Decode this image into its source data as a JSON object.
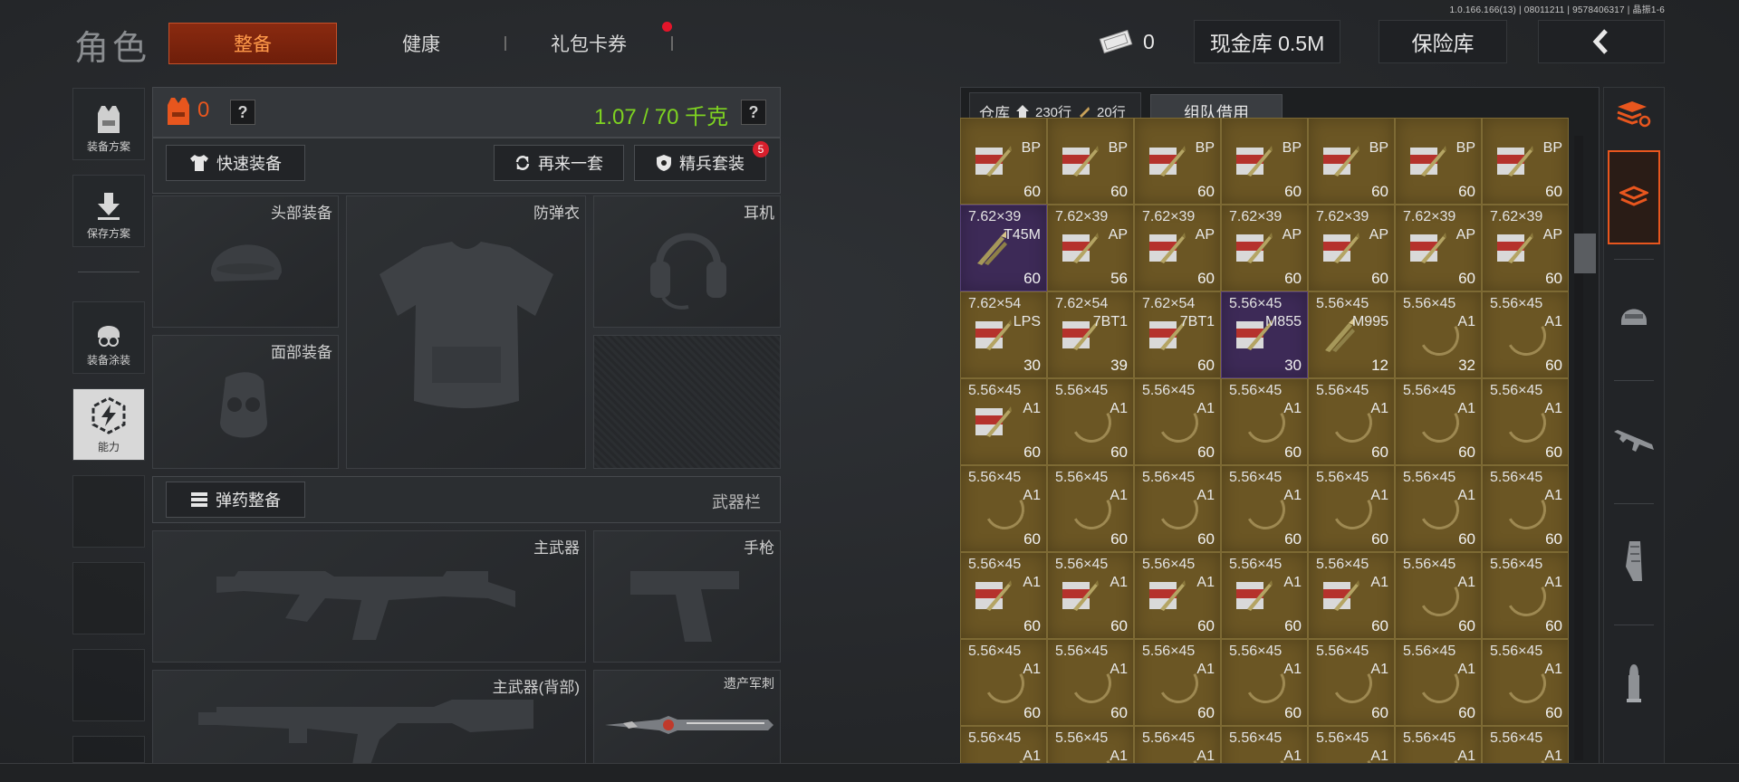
{
  "version": "1.0.166.166(13) | 08011211 | 9578406317 | 晶振1-6",
  "header": {
    "title": "角色",
    "tabs": [
      {
        "label": "整备",
        "active": true
      },
      {
        "label": "健康",
        "active": false
      },
      {
        "label": "礼包卡券",
        "active": false,
        "has_dot": true
      }
    ],
    "cash_tickets": "0",
    "cash_vault": "现金库 0.5M",
    "safe": "保险库",
    "back_icon": "chevron-left-icon"
  },
  "sidebar": {
    "items": [
      {
        "label": "装备方案",
        "icon": "vest-icon"
      },
      {
        "label": "保存方案",
        "icon": "download-arrow-icon"
      },
      {
        "label": "装备涂装",
        "icon": "helmet-paint-icon"
      },
      {
        "label": "能力",
        "icon": "lightning-hex-icon",
        "active": true
      }
    ]
  },
  "equip": {
    "armor_count": "0",
    "help": "?",
    "weight": "1.07 / 70 千克",
    "quick_equip": "快速装备",
    "again_set": "再来一套",
    "elite_set": "精兵套装",
    "elite_badge": "5",
    "slots": {
      "head": "头部装备",
      "vest": "防弹衣",
      "ear": "耳机",
      "face": "面部装备",
      "primary": "主武器",
      "pistol": "手枪",
      "primary_back": "主武器(背部)",
      "melee": "遗产军刺"
    },
    "ammo_equip": "弹药整备",
    "weapon_bar": "武器栏"
  },
  "warehouse": {
    "label": "仓库",
    "home_rows": "230行",
    "ammo_rows": "20行",
    "team_borrow": "组队借用",
    "rows": [
      [
        {
          "cal": "",
          "type": "BP",
          "count": "60",
          "kind": "box"
        },
        {
          "cal": "",
          "type": "BP",
          "count": "60",
          "kind": "box"
        },
        {
          "cal": "",
          "type": "BP",
          "count": "60",
          "kind": "box"
        },
        {
          "cal": "",
          "type": "BP",
          "count": "60",
          "kind": "box"
        },
        {
          "cal": "",
          "type": "BP",
          "count": "60",
          "kind": "box"
        },
        {
          "cal": "",
          "type": "BP",
          "count": "60",
          "kind": "box"
        },
        {
          "cal": "",
          "type": "BP",
          "count": "60",
          "kind": "box"
        }
      ],
      [
        {
          "cal": "7.62×39",
          "type": "T45M",
          "count": "60",
          "kind": "bullet",
          "purple": true
        },
        {
          "cal": "7.62×39",
          "type": "AP",
          "count": "56",
          "kind": "box"
        },
        {
          "cal": "7.62×39",
          "type": "AP",
          "count": "60",
          "kind": "box"
        },
        {
          "cal": "7.62×39",
          "type": "AP",
          "count": "60",
          "kind": "box"
        },
        {
          "cal": "7.62×39",
          "type": "AP",
          "count": "60",
          "kind": "box"
        },
        {
          "cal": "7.62×39",
          "type": "AP",
          "count": "60",
          "kind": "box"
        },
        {
          "cal": "7.62×39",
          "type": "AP",
          "count": "60",
          "kind": "box"
        }
      ],
      [
        {
          "cal": "7.62×54",
          "type": "LPS",
          "count": "30",
          "kind": "box"
        },
        {
          "cal": "7.62×54",
          "type": "7BT1",
          "count": "39",
          "kind": "box"
        },
        {
          "cal": "7.62×54",
          "type": "7BT1",
          "count": "60",
          "kind": "box"
        },
        {
          "cal": "5.56×45",
          "type": "M855",
          "count": "30",
          "kind": "box",
          "purple": true
        },
        {
          "cal": "5.56×45",
          "type": "M995",
          "count": "12",
          "kind": "bullet"
        },
        {
          "cal": "5.56×45",
          "type": "A1",
          "count": "32",
          "kind": "ring"
        },
        {
          "cal": "5.56×45",
          "type": "A1",
          "count": "60",
          "kind": "ring"
        }
      ],
      [
        {
          "cal": "5.56×45",
          "type": "A1",
          "count": "60",
          "kind": "box"
        },
        {
          "cal": "5.56×45",
          "type": "A1",
          "count": "60",
          "kind": "ring"
        },
        {
          "cal": "5.56×45",
          "type": "A1",
          "count": "60",
          "kind": "ring"
        },
        {
          "cal": "5.56×45",
          "type": "A1",
          "count": "60",
          "kind": "ring"
        },
        {
          "cal": "5.56×45",
          "type": "A1",
          "count": "60",
          "kind": "ring"
        },
        {
          "cal": "5.56×45",
          "type": "A1",
          "count": "60",
          "kind": "ring"
        },
        {
          "cal": "5.56×45",
          "type": "A1",
          "count": "60",
          "kind": "ring"
        }
      ],
      [
        {
          "cal": "5.56×45",
          "type": "A1",
          "count": "60",
          "kind": "ring"
        },
        {
          "cal": "5.56×45",
          "type": "A1",
          "count": "60",
          "kind": "ring"
        },
        {
          "cal": "5.56×45",
          "type": "A1",
          "count": "60",
          "kind": "ring"
        },
        {
          "cal": "5.56×45",
          "type": "A1",
          "count": "60",
          "kind": "ring"
        },
        {
          "cal": "5.56×45",
          "type": "A1",
          "count": "60",
          "kind": "ring"
        },
        {
          "cal": "5.56×45",
          "type": "A1",
          "count": "60",
          "kind": "ring"
        },
        {
          "cal": "5.56×45",
          "type": "A1",
          "count": "60",
          "kind": "ring"
        }
      ],
      [
        {
          "cal": "5.56×45",
          "type": "A1",
          "count": "60",
          "kind": "box"
        },
        {
          "cal": "5.56×45",
          "type": "A1",
          "count": "60",
          "kind": "box"
        },
        {
          "cal": "5.56×45",
          "type": "A1",
          "count": "60",
          "kind": "box"
        },
        {
          "cal": "5.56×45",
          "type": "A1",
          "count": "60",
          "kind": "box"
        },
        {
          "cal": "5.56×45",
          "type": "A1",
          "count": "60",
          "kind": "box"
        },
        {
          "cal": "5.56×45",
          "type": "A1",
          "count": "60",
          "kind": "ring"
        },
        {
          "cal": "5.56×45",
          "type": "A1",
          "count": "60",
          "kind": "ring"
        }
      ],
      [
        {
          "cal": "5.56×45",
          "type": "A1",
          "count": "60",
          "kind": "ring"
        },
        {
          "cal": "5.56×45",
          "type": "A1",
          "count": "60",
          "kind": "ring"
        },
        {
          "cal": "5.56×45",
          "type": "A1",
          "count": "60",
          "kind": "ring"
        },
        {
          "cal": "5.56×45",
          "type": "A1",
          "count": "60",
          "kind": "ring"
        },
        {
          "cal": "5.56×45",
          "type": "A1",
          "count": "60",
          "kind": "ring"
        },
        {
          "cal": "5.56×45",
          "type": "A1",
          "count": "60",
          "kind": "ring"
        },
        {
          "cal": "5.56×45",
          "type": "A1",
          "count": "60",
          "kind": "ring"
        }
      ],
      [
        {
          "cal": "5.56×45",
          "type": "A1",
          "count": "",
          "kind": "ring"
        },
        {
          "cal": "5.56×45",
          "type": "A1",
          "count": "",
          "kind": "ring"
        },
        {
          "cal": "5.56×45",
          "type": "A1",
          "count": "",
          "kind": "ring"
        },
        {
          "cal": "5.56×45",
          "type": "A1",
          "count": "",
          "kind": "ring"
        },
        {
          "cal": "5.56×45",
          "type": "A1",
          "count": "",
          "kind": "ring"
        },
        {
          "cal": "5.56×45",
          "type": "A1",
          "count": "",
          "kind": "ring"
        },
        {
          "cal": "5.56×45",
          "type": "A1",
          "count": "",
          "kind": "ring"
        }
      ]
    ]
  },
  "categories": [
    {
      "icon": "stack-refresh-icon",
      "active": false
    },
    {
      "icon": "layers-icon",
      "active": true
    },
    {
      "icon": "helmet-icon",
      "active": false
    },
    {
      "icon": "rifle-icon",
      "active": false
    },
    {
      "icon": "magazine-icon",
      "active": false
    },
    {
      "icon": "bullet-icon",
      "active": false
    }
  ],
  "colors": {
    "accent": "#e8561e",
    "weight_green": "#7ed321",
    "cell_gold": "#6b5624",
    "cell_purple": "#3d2a57"
  }
}
